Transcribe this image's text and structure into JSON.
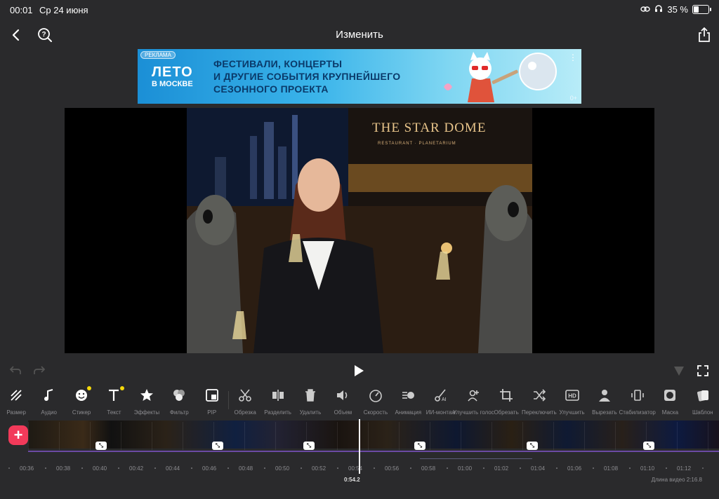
{
  "status": {
    "time": "00:01",
    "date": "Ср 24 июня",
    "battery": "35 %",
    "battery_level": 0.35
  },
  "header": {
    "title": "Изменить"
  },
  "ad": {
    "tag": "РЕКЛАМА",
    "logo_line1": "ЛЕТО",
    "logo_line2": "В МОСКВЕ",
    "text_lines": [
      "ФЕСТИВАЛИ, КОНЦЕРТЫ",
      "И ДРУГИЕ СОБЫТИЯ КРУПНЕЙШЕГО",
      "СЕЗОННОГО ПРОЕКТА"
    ],
    "age": "0+"
  },
  "preview": {
    "sign": "THE STAR DOME",
    "sign_sub": "RESTAURANT · PLANETARIUM"
  },
  "toolbar": [
    {
      "label": "Размер",
      "icon": "resize-icon"
    },
    {
      "label": "Аудио",
      "icon": "music-note-icon"
    },
    {
      "label": "Стикер",
      "icon": "smiley-icon",
      "dot": true
    },
    {
      "label": "Текст",
      "icon": "text-icon",
      "dot": true
    },
    {
      "label": "Эффекты",
      "icon": "star-icon"
    },
    {
      "label": "Фильтр",
      "icon": "filter-icon"
    },
    {
      "label": "PIP",
      "icon": "pip-icon"
    },
    {
      "label": "Обрезка",
      "icon": "scissors-icon"
    },
    {
      "label": "Разделить",
      "icon": "split-icon"
    },
    {
      "label": "Удалить",
      "icon": "trash-icon"
    },
    {
      "label": "Объем",
      "icon": "volume-icon"
    },
    {
      "label": "Скорость",
      "icon": "speedometer-icon"
    },
    {
      "label": "Анимация",
      "icon": "animation-icon"
    },
    {
      "label": "ИИ-монтаж",
      "icon": "ai-cut-icon"
    },
    {
      "label": "Улучшить голос",
      "icon": "voice-enhance-icon"
    },
    {
      "label": "Обрезать",
      "icon": "crop-icon"
    },
    {
      "label": "Переключить",
      "icon": "shuffle-icon"
    },
    {
      "label": "Улучшить",
      "icon": "hd-icon"
    },
    {
      "label": "Вырезать",
      "icon": "person-cutout-icon"
    },
    {
      "label": "Стабилизатор",
      "icon": "stabilizer-icon"
    },
    {
      "label": "Маска",
      "icon": "mask-icon"
    },
    {
      "label": "Шаблон",
      "icon": "template-icon"
    }
  ],
  "timeline": {
    "ticks": [
      "00:36",
      "00:38",
      "00:40",
      "00:42",
      "00:44",
      "00:46",
      "00:48",
      "00:50",
      "00:52",
      "00:54",
      "00:56",
      "00:58",
      "01:00",
      "01:02",
      "01:04",
      "01:06",
      "01:08",
      "01:10",
      "01:12"
    ],
    "current": "0:54.2",
    "duration": "Длина видео 2:16.8"
  }
}
